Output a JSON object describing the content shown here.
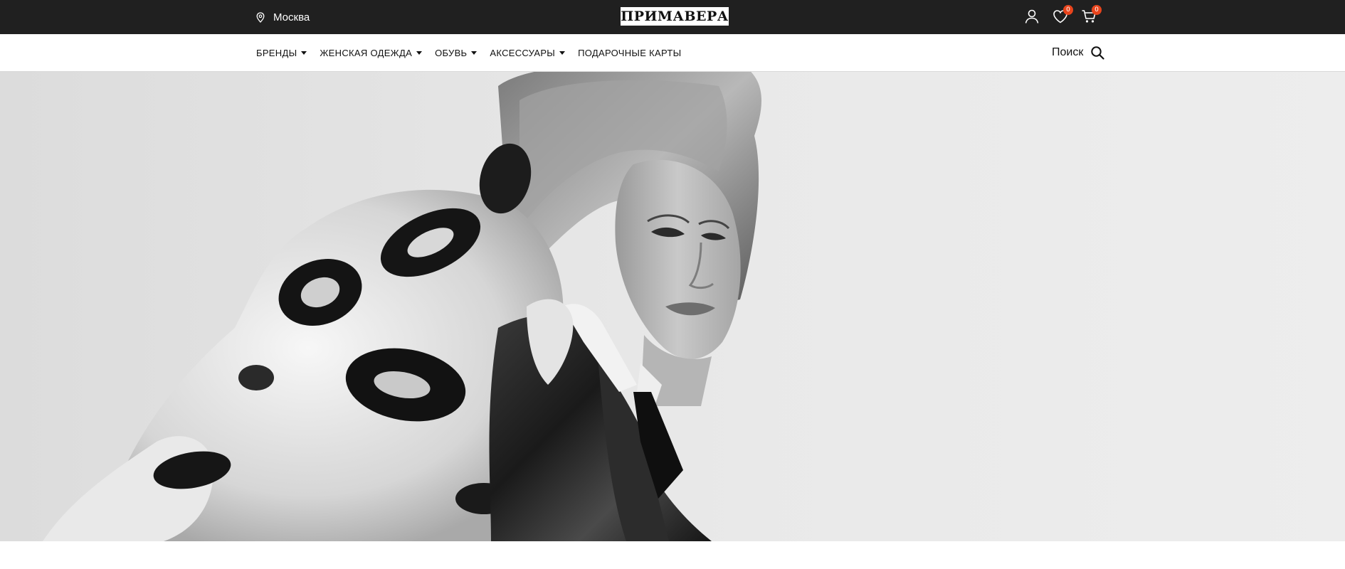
{
  "header": {
    "city": "Москва",
    "logo": "ПРИМАВЕРА",
    "icons": {
      "location": "location-pin-icon",
      "account": "user-icon",
      "wishlist": "heart-icon",
      "cart": "cart-icon"
    },
    "wishlist_count": "0",
    "cart_count": "0"
  },
  "nav": {
    "items": [
      {
        "label": "БРЕНДЫ",
        "dropdown": true
      },
      {
        "label": "ЖЕНСКАЯ ОДЕЖДА",
        "dropdown": true
      },
      {
        "label": "ОБУВЬ",
        "dropdown": true
      },
      {
        "label": "АКСЕССУАРЫ",
        "dropdown": true
      },
      {
        "label": "ПОДАРОЧНЫЕ КАРТЫ",
        "dropdown": false
      }
    ],
    "search_label": "Поиск",
    "search_icon": "search-icon"
  },
  "colors": {
    "topbar": "#202020",
    "badge": "#e8441c",
    "accent_text": "#111111"
  }
}
